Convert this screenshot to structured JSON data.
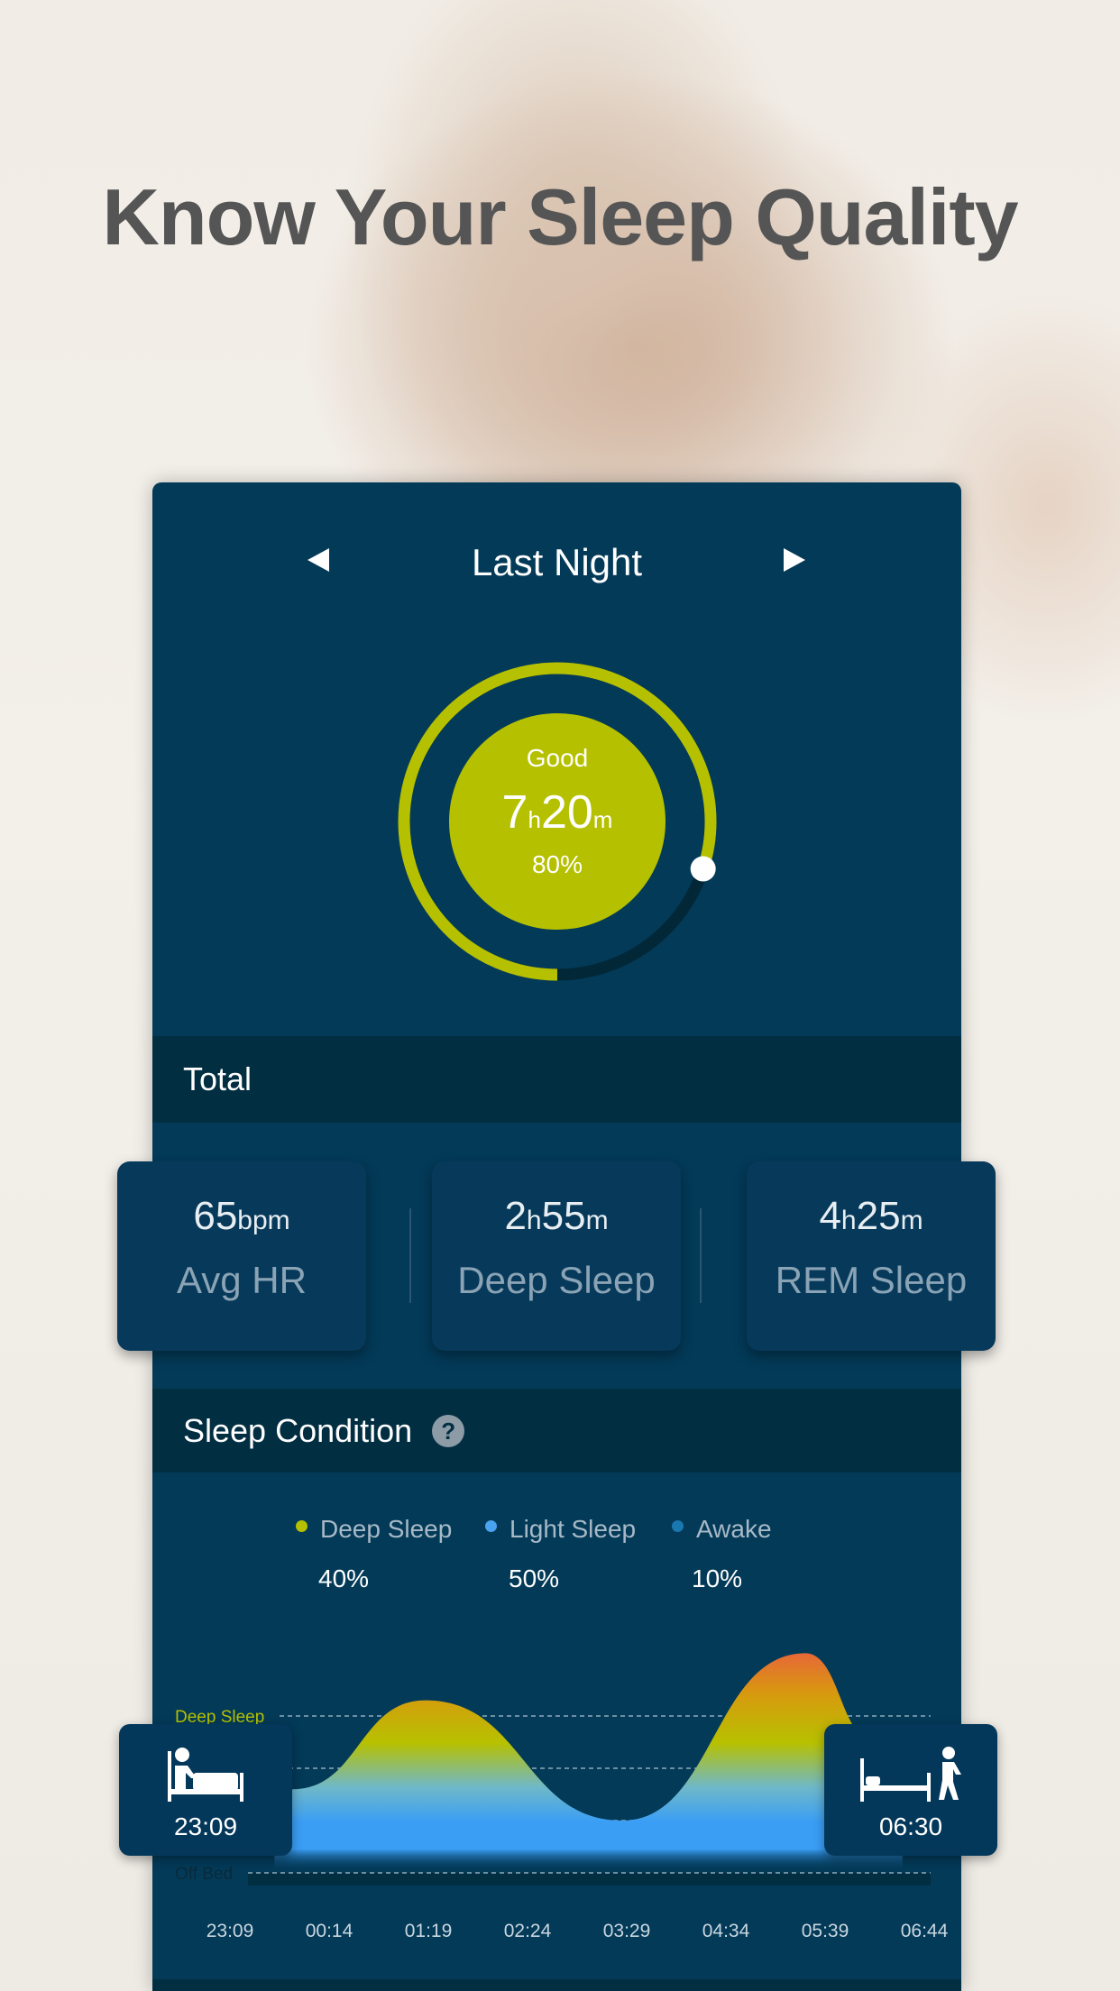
{
  "headline": "Know Your Sleep Quality",
  "nav": {
    "title": "Last Night",
    "prev": "previous-day",
    "next": "next-day"
  },
  "score": {
    "rating": "Good",
    "hours": "7",
    "hours_unit": "h",
    "minutes": "20",
    "minutes_unit": "m",
    "percent": "80%",
    "progress": 0.8,
    "ring_color": "#b5c000"
  },
  "total": {
    "label": "Total"
  },
  "stats": [
    {
      "value": "65",
      "unit": "bpm",
      "label": "Avg HR"
    },
    {
      "value": "2",
      "unit1": "h",
      "value2": "55",
      "unit2": "m",
      "label": "Deep Sleep"
    },
    {
      "value": "4",
      "unit1": "h",
      "value2": "25",
      "unit2": "m",
      "label": "REM Sleep"
    }
  ],
  "condition": {
    "label": "Sleep Condition",
    "help_icon": "question-icon",
    "legend": [
      {
        "label": "Deep Sleep",
        "percent": "40%",
        "color": "#b5c000"
      },
      {
        "label": "Light Sleep",
        "percent": "50%",
        "color": "#4aa3f0"
      },
      {
        "label": "Awake",
        "percent": "10%",
        "color": "#1a78b0"
      }
    ]
  },
  "chart_data": {
    "type": "area",
    "y_level_labels": {
      "top": "Deep Sleep",
      "bottom": "Off Bed"
    },
    "x_ticks": [
      "23:09",
      "00:14",
      "01:19",
      "02:24",
      "03:29",
      "04:34",
      "05:39",
      "06:44"
    ],
    "points": [
      [
        "23:50",
        1.6
      ],
      [
        "01:17",
        3.3
      ],
      [
        "03:26",
        1.0
      ],
      [
        "05:26",
        4.2
      ],
      [
        "06:12",
        2.5
      ]
    ],
    "bed_time": "23:09",
    "wake_time": "06:30"
  }
}
